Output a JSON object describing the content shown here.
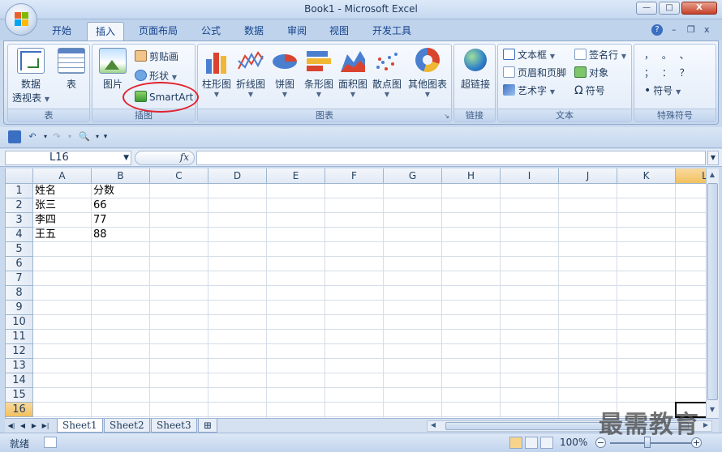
{
  "window": {
    "title": "Book1 - Microsoft Excel"
  },
  "window_controls": {
    "minimize": "—",
    "maximize": "□",
    "close": "X"
  },
  "doc_controls": {
    "help": "?",
    "minimize": "–",
    "restore": "❐",
    "close": "x"
  },
  "tabs": [
    "开始",
    "插入",
    "页面布局",
    "公式",
    "数据",
    "审阅",
    "视图",
    "开发工具"
  ],
  "active_tab": "插入",
  "ribbon": {
    "groups": {
      "tables": {
        "label": "表",
        "pivot_line1": "数据",
        "pivot_line2": "透视表",
        "table": "表"
      },
      "illustrations": {
        "label": "插图",
        "picture": "图片",
        "clipart": "剪贴画",
        "shapes": "形状",
        "smartart": "SmartArt"
      },
      "charts": {
        "label": "图表",
        "column": "柱形图",
        "line": "折线图",
        "pie": "饼图",
        "bar": "条形图",
        "area": "面积图",
        "scatter": "散点图",
        "other": "其他图表"
      },
      "links": {
        "label": "链接",
        "hyperlink": "超链接"
      },
      "text": {
        "label": "文本",
        "textbox": "文本框",
        "header_footer": "页眉和页脚",
        "wordart": "艺术字",
        "signature": "签名行",
        "object": "对象",
        "symbol": "符号"
      },
      "special": {
        "label": "特殊符号",
        "symbols_row1": "，  。  、",
        "symbols_row2": "；  ：  ？",
        "symbol_btn": "符号"
      }
    }
  },
  "formula_bar": {
    "name_box": "L16",
    "fx_label": "fx",
    "formula": ""
  },
  "columns": [
    "A",
    "B",
    "C",
    "D",
    "E",
    "F",
    "G",
    "H",
    "I",
    "J",
    "K",
    "L"
  ],
  "rows": [
    "1",
    "2",
    "3",
    "4",
    "5",
    "6",
    "7",
    "8",
    "9",
    "10",
    "11",
    "12",
    "13",
    "14",
    "15",
    "16"
  ],
  "cells": {
    "A1": "姓名",
    "B1": "分数",
    "A2": "张三",
    "B2": "66",
    "A3": "李四",
    "B3": "77",
    "A4": "王五",
    "B4": "88"
  },
  "active_cell": "L16",
  "sheets": [
    "Sheet1",
    "Sheet2",
    "Sheet3"
  ],
  "active_sheet": "Sheet1",
  "status": {
    "ready": "就绪",
    "zoom": "100%"
  },
  "watermark": "最需教育",
  "colors": {
    "accent_red": "#e0232e",
    "selected_header": "#f1c15f",
    "ribbon_text": "#15428b"
  }
}
